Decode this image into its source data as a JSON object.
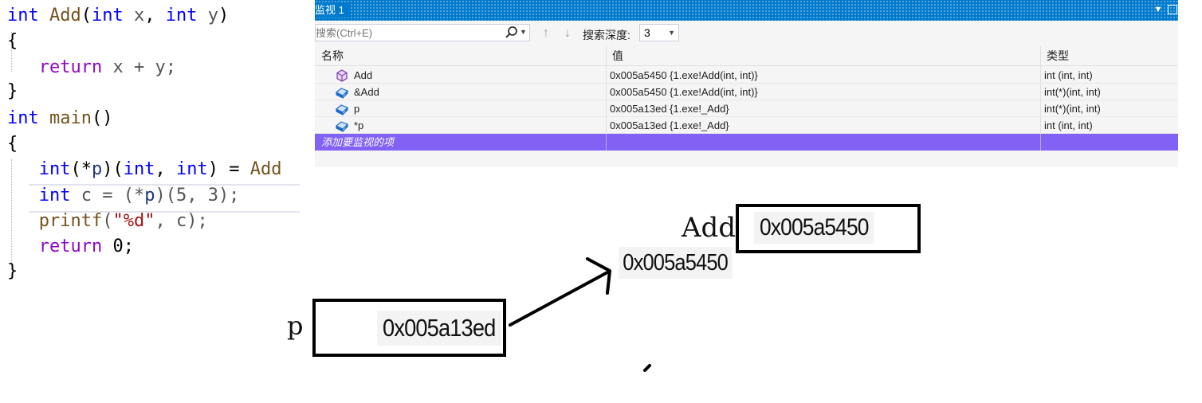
{
  "code": {
    "line1": {
      "kw": "int",
      "fn": "Add",
      "open": "(",
      "kw2": "int",
      "p1": "x",
      "comma": ",",
      "kw3": "int",
      "p2": "y",
      "close": ")"
    },
    "line2": "{",
    "line3": {
      "kw": "return",
      "rest": " x + y;"
    },
    "line4": "}",
    "line5": {
      "kw": "int",
      "fn": "main",
      "rest": "()"
    },
    "line6": "{",
    "line7": {
      "kw": "int",
      "a": "(*",
      "id": "p",
      "b": ")(",
      "kw2": "int",
      "c": ", ",
      "kw3": "int",
      "d": ") = ",
      "fn": "Add"
    },
    "line8": {
      "kw": "int",
      "a": " c = (*",
      "id": "p",
      "b": ")(5, 3);"
    },
    "line9": {
      "fn": "printf",
      "a": "(",
      "str": "\"%d\"",
      "b": ", c);"
    },
    "line10": {
      "kw": "return",
      "rest": " 0;"
    },
    "line11": "}"
  },
  "watch": {
    "title": "监视 1",
    "search_placeholder": "搜索(Ctrl+E)",
    "depth_label": "搜索深度:",
    "depth_value": "3",
    "columns": {
      "name": "名称",
      "value": "值",
      "type": "类型"
    },
    "rows": [
      {
        "name": "Add",
        "value": "0x005a5450 {1.exe!Add(int, int)}",
        "type": "int (int, int)",
        "icon": "method-icon"
      },
      {
        "name": "&Add",
        "value": "0x005a5450 {1.exe!Add(int, int)}",
        "type": "int(*)(int, int)",
        "icon": "pointer-icon"
      },
      {
        "name": "p",
        "value": "0x005a13ed {1.exe!_Add}",
        "type": "int(*)(int, int)",
        "icon": "pointer-icon"
      },
      {
        "name": "*p",
        "value": "0x005a13ed {1.exe!_Add}",
        "type": "int (int, int)",
        "icon": "pointer-icon"
      }
    ],
    "add_item_placeholder": "添加要监视的项"
  },
  "diagram": {
    "add_label": "Add",
    "add_value": "0x005a5450",
    "target_value": "0x005a5450",
    "p_label": "p",
    "p_value": "0x005a13ed"
  },
  "colors": {
    "titlebar": "#007acc",
    "add_row_highlight": "#8261f5",
    "keyword": "#0000ff",
    "function": "#74531f",
    "string": "#a31515"
  }
}
